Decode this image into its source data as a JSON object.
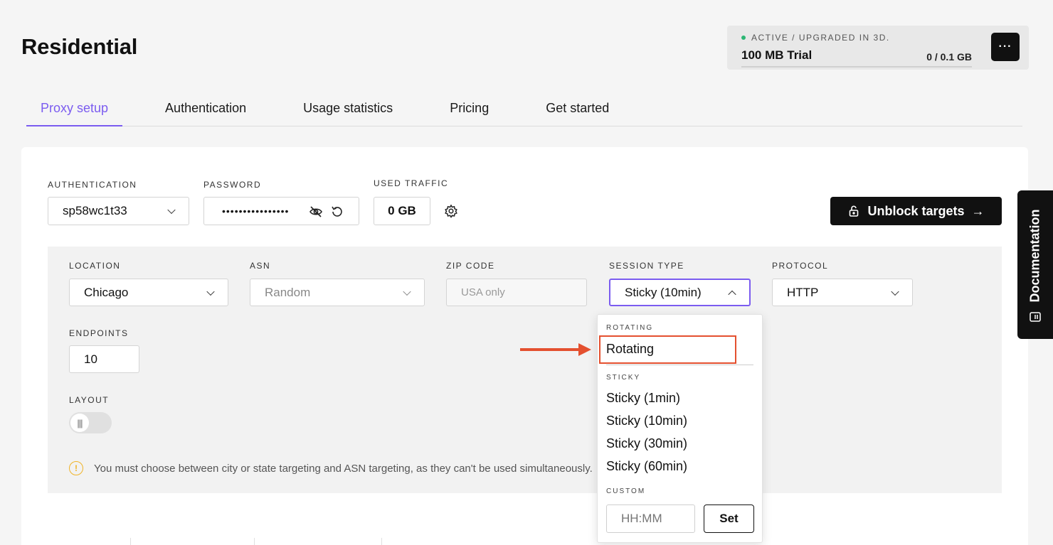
{
  "page": {
    "title": "Residential"
  },
  "plan": {
    "status": "ACTIVE / UPGRADED IN 3D.",
    "name": "100 MB Trial",
    "usage": "0 / 0.1 GB",
    "usage_fraction": 0,
    "menu": "···"
  },
  "tabs": [
    {
      "label": "Proxy setup",
      "active": true
    },
    {
      "label": "Authentication"
    },
    {
      "label": "Usage statistics"
    },
    {
      "label": "Pricing"
    },
    {
      "label": "Get started"
    }
  ],
  "auth": {
    "label": "AUTHENTICATION",
    "value": "sp58wc1t33",
    "password_label": "PASSWORD",
    "password_value": "••••••••••••••••",
    "traffic_label": "USED TRAFFIC",
    "traffic_value": "0 GB",
    "unblock_label": "Unblock targets"
  },
  "filters": {
    "location_label": "LOCATION",
    "location_value": "Chicago",
    "asn_label": "ASN",
    "asn_value": "Random",
    "zip_label": "ZIP CODE",
    "zip_placeholder": "USA only",
    "session_label": "SESSION TYPE",
    "session_value": "Sticky (10min)",
    "protocol_label": "PROTOCOL",
    "protocol_value": "HTTP",
    "endpoints_label": "ENDPOINTS",
    "endpoints_value": "10",
    "layout_label": "LAYOUT"
  },
  "warning": "You must choose between city or state targeting and ASN targeting, as they can't be used simultaneously.",
  "dropdown": {
    "rotating_header": "ROTATING",
    "rotating_item": "Rotating",
    "sticky_header": "STICKY",
    "sticky_items": [
      "Sticky (1min)",
      "Sticky (10min)",
      "Sticky (30min)",
      "Sticky (60min)"
    ],
    "custom_header": "CUSTOM",
    "custom_placeholder": "HH:MM",
    "set_label": "Set"
  },
  "sidebar": {
    "documentation": "Documentation"
  },
  "colors": {
    "accent": "#7b5cf0",
    "highlight": "#e4502f",
    "dark": "#111111",
    "status": "#2bb673"
  }
}
